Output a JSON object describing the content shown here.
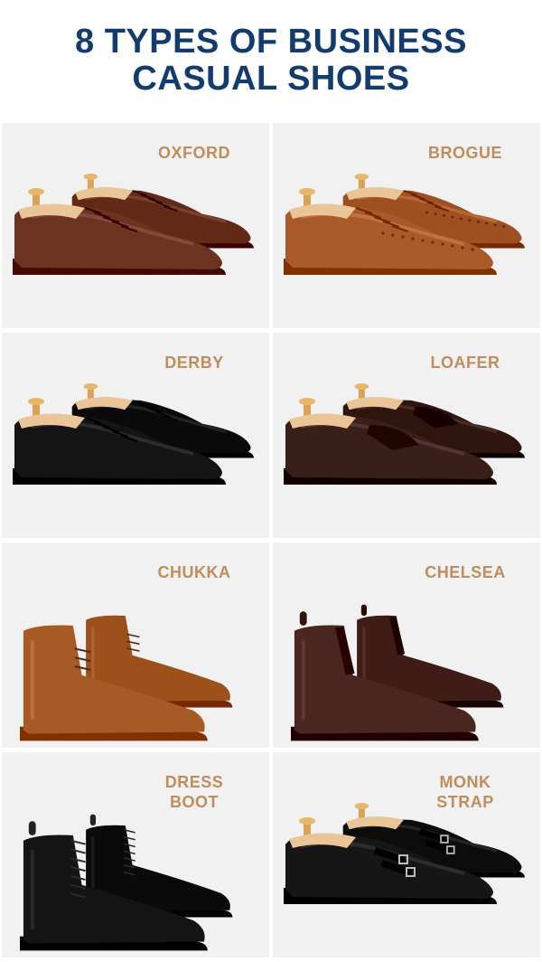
{
  "header": {
    "title_line1": "8 TYPES OF BUSINESS",
    "title_line2": "CASUAL SHOES"
  },
  "colors": {
    "title": "#123c6e",
    "label": "#c08d5c",
    "card_bg": "#f1f1f1"
  },
  "shoes": [
    {
      "name_lines": [
        "OXFORD"
      ],
      "color": "#6b3320",
      "icon": "oxford-shoe-icon"
    },
    {
      "name_lines": [
        "BROGUE"
      ],
      "color": "#a95a2a",
      "icon": "brogue-shoe-icon"
    },
    {
      "name_lines": [
        "DERBY"
      ],
      "color": "#141414",
      "icon": "derby-shoe-icon"
    },
    {
      "name_lines": [
        "LOAFER"
      ],
      "color": "#3a1e18",
      "icon": "loafer-shoe-icon"
    },
    {
      "name_lines": [
        "CHUKKA"
      ],
      "color": "#a85a24",
      "icon": "chukka-boot-icon"
    },
    {
      "name_lines": [
        "CHELSEA"
      ],
      "color": "#4a2620",
      "icon": "chelsea-boot-icon"
    },
    {
      "name_lines": [
        "DRESS",
        "BOOT"
      ],
      "color": "#141414",
      "icon": "dress-boot-icon"
    },
    {
      "name_lines": [
        "MONK",
        "STRAP"
      ],
      "color": "#161616",
      "icon": "monk-strap-shoe-icon"
    }
  ]
}
